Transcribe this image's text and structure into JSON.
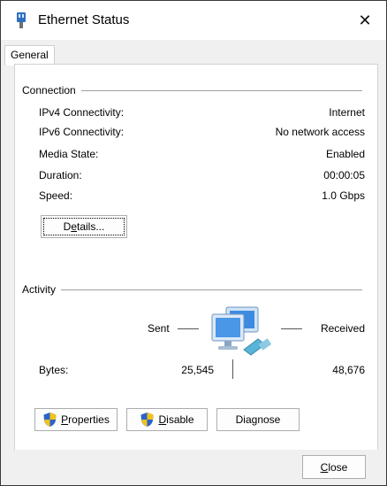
{
  "window": {
    "title": "Ethernet Status",
    "close_glyph": "✕"
  },
  "tabs": [
    {
      "label": "General"
    }
  ],
  "connection": {
    "group_label": "Connection",
    "rows": [
      {
        "label": "IPv4 Connectivity:",
        "value": "Internet"
      },
      {
        "label": "IPv6 Connectivity:",
        "value": "No network access"
      },
      {
        "label": "Media State:",
        "value": "Enabled"
      },
      {
        "label": "Duration:",
        "value": "00:00:05"
      },
      {
        "label": "Speed:",
        "value": "1.0 Gbps"
      }
    ],
    "details_button": {
      "pre": "D",
      "accel": "e",
      "post": "tails..."
    }
  },
  "activity": {
    "group_label": "Activity",
    "sent_label": "Sent",
    "received_label": "Received",
    "bytes_label": "Bytes:",
    "bytes_sent": "25,545",
    "bytes_received": "48,676"
  },
  "buttons": {
    "properties": {
      "accel": "P",
      "rest": "roperties"
    },
    "disable": {
      "accel": "D",
      "rest": "isable"
    },
    "diagnose": {
      "pre": "Dia",
      "accel": "g",
      "post": "nose"
    },
    "close": {
      "accel": "C",
      "rest": "lose"
    }
  },
  "icons": {
    "title": "network-adapter-icon",
    "shield": "uac-shield-icon",
    "activity": "network-computers-icon"
  },
  "colors": {
    "shield_blue": "#2a63c9",
    "shield_yellow": "#f2c21b",
    "monitor_blue": "#3d8be0"
  }
}
